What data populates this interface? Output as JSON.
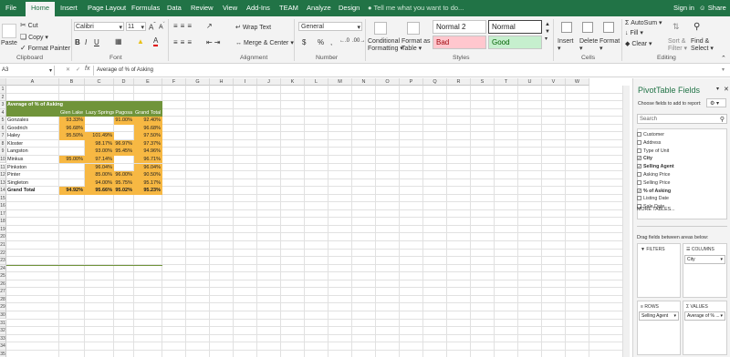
{
  "tabs": [
    "File",
    "Home",
    "Insert",
    "Page Layout",
    "Formulas",
    "Data",
    "Review",
    "View",
    "Add-Ins",
    "TEAM",
    "Analyze",
    "Design"
  ],
  "tell_me": "Tell me what you want to do...",
  "sign_in": "Sign in",
  "share": "Share",
  "clipboard": {
    "paste": "Paste",
    "cut": "Cut",
    "copy": "Copy",
    "format_painter": "Format Painter",
    "group": "Clipboard"
  },
  "font": {
    "name": "Calibri",
    "size": "11",
    "bold": "B",
    "italic": "I",
    "underline": "U",
    "group": "Font"
  },
  "alignment": {
    "wrap": "Wrap Text",
    "merge": "Merge & Center",
    "group": "Alignment"
  },
  "number": {
    "format": "General",
    "currency": "$",
    "percent": "%",
    "comma": ",",
    "group": "Number"
  },
  "styles": {
    "cond_fmt_1": "Conditional",
    "cond_fmt_2": "Formatting",
    "format_table_1": "Format as",
    "format_table_2": "Table",
    "normal2": "Normal 2",
    "normal": "Normal",
    "bad": "Bad",
    "good": "Good",
    "group": "Styles"
  },
  "cells": {
    "insert": "Insert",
    "delete": "Delete",
    "format": "Format",
    "group": "Cells"
  },
  "editing": {
    "autosum": "AutoSum",
    "fill": "Fill",
    "clear": "Clear",
    "sort_1": "Sort &",
    "sort_2": "Filter",
    "find_1": "Find &",
    "find_2": "Select",
    "group": "Editing"
  },
  "formula_bar": {
    "name_box": "A3",
    "fx": "fx",
    "formula": "Average of % of Asking"
  },
  "columns": [
    "A",
    "B",
    "C",
    "D",
    "E",
    "F",
    "G",
    "H",
    "I",
    "J",
    "K",
    "L",
    "M",
    "N",
    "O",
    "P",
    "Q",
    "R",
    "S",
    "T",
    "U",
    "V",
    "W"
  ],
  "rows": [
    "1",
    "2",
    "3",
    "4",
    "5",
    "6",
    "7",
    "8",
    "9",
    "10",
    "11",
    "12",
    "13",
    "14",
    "15",
    "16",
    "17",
    "18",
    "19",
    "20",
    "21",
    "22",
    "23",
    "24",
    "25",
    "26",
    "27",
    "28",
    "29",
    "30",
    "31",
    "32",
    "33",
    "34",
    "35"
  ],
  "pivot": {
    "title": "Average of % of Asking",
    "headers": [
      "",
      "Glen Lake",
      "Lazy Springs",
      "Pagosa",
      "Grand Total"
    ],
    "rows": [
      [
        "Gonzales",
        "93.33%",
        "",
        "91.00%",
        "92.40%"
      ],
      [
        "Goodrich",
        "96.68%",
        "",
        "",
        "96.68%"
      ],
      [
        "Haley",
        "95.50%",
        "101.49%",
        "",
        "97.50%"
      ],
      [
        "Kloster",
        "",
        "98.17%",
        "96.97%",
        "97.37%"
      ],
      [
        "Langston",
        "",
        "93.00%",
        "95.45%",
        "94.96%"
      ],
      [
        "Minkus",
        "95.00%",
        "97.14%",
        "",
        "96.71%"
      ],
      [
        "Pinkston",
        "",
        "96.04%",
        "",
        "96.04%"
      ],
      [
        "Pinter",
        "",
        "85.00%",
        "96.00%",
        "90.50%"
      ],
      [
        "Singleton",
        "",
        "94.00%",
        "95.75%",
        "95.17%"
      ]
    ],
    "total": [
      "Grand Total",
      "94.92%",
      "95.66%",
      "95.02%",
      "95.23%"
    ]
  },
  "panel": {
    "title": "PivotTable Fields",
    "choose": "Choose fields to add to report:",
    "search": "Search",
    "fields": [
      {
        "name": "Customer",
        "checked": false
      },
      {
        "name": "Address",
        "checked": false
      },
      {
        "name": "Type of Unit",
        "checked": false
      },
      {
        "name": "City",
        "checked": true
      },
      {
        "name": "Selling Agent",
        "checked": true
      },
      {
        "name": "Asking Price",
        "checked": false
      },
      {
        "name": "Selling Price",
        "checked": false
      },
      {
        "name": "% of Asking",
        "checked": true
      },
      {
        "name": "Listing Date",
        "checked": false
      },
      {
        "name": "Sale Date",
        "checked": false
      }
    ],
    "more": "MORE TABLES...",
    "drag": "Drag fields between areas below:",
    "filters": "FILTERS",
    "columns": "COLUMNS",
    "col_chip": "City",
    "rows_label": "ROWS",
    "values": "VALUES",
    "row_chip": "Selling Agent",
    "val_chip": "Average of % ..."
  },
  "colors": {
    "accent": "#217346",
    "heat": "#f7b843",
    "pivot_header": "#70943a"
  }
}
